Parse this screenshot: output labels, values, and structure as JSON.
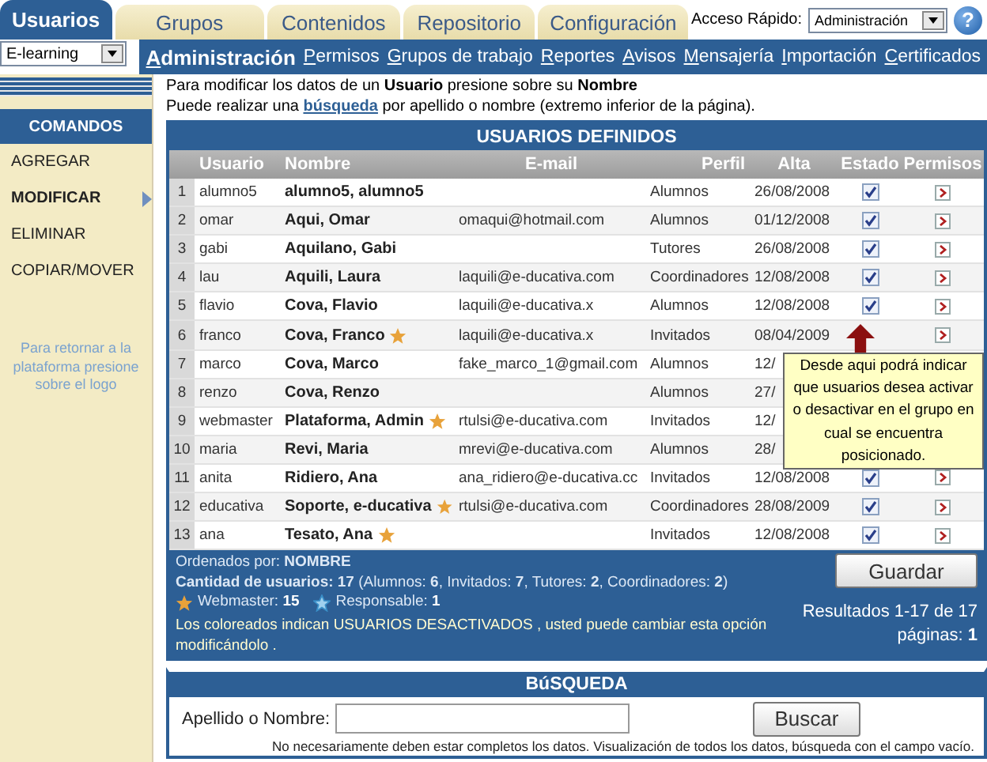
{
  "top_tabs": [
    {
      "label": "Usuarios",
      "selected": true
    },
    {
      "label": "Grupos",
      "selected": false
    },
    {
      "label": "Contenidos",
      "selected": false
    },
    {
      "label": "Repositorio",
      "selected": false
    },
    {
      "label": "Configuración",
      "selected": false
    }
  ],
  "quick_access": {
    "label": "Acceso Rápido:",
    "value": "Administración"
  },
  "help": "?",
  "platform_select": {
    "value": "E-learning"
  },
  "nav_links": [
    {
      "label": "Administración",
      "selected": true
    },
    {
      "label": "Permisos",
      "selected": false
    },
    {
      "label": "Grupos de trabajo",
      "selected": false
    },
    {
      "label": "Reportes",
      "selected": false
    },
    {
      "label": "Avisos",
      "selected": false
    },
    {
      "label": "Mensajería",
      "selected": false
    },
    {
      "label": "Importación",
      "selected": false
    },
    {
      "label": "Certificados",
      "selected": false
    }
  ],
  "sidebar": {
    "title": "COMANDOS",
    "items": [
      {
        "label": "AGREGAR",
        "selected": false
      },
      {
        "label": "MODIFICAR",
        "selected": true
      },
      {
        "label": "ELIMINAR",
        "selected": false
      },
      {
        "label": "COPIAR/MOVER",
        "selected": false
      }
    ],
    "note": "Para retornar a la plataforma presione sobre el logo"
  },
  "instructions": {
    "line_1": "Para modificar los datos de un **Usuario** presione sobre su **Nombre**",
    "before_link": "Puede realizar una",
    "link": "búsqueda",
    "after_link": "por apellido o nombre (extremo inferior de la página)."
  },
  "table": {
    "title": "USUARIOS DEFINIDOS",
    "columns": [
      "Usuario",
      "Nombre",
      "E-mail",
      "Perfil",
      "Alta",
      "Estado",
      "Permisos"
    ],
    "rows": [
      {
        "n": "1",
        "usuario": "alumno5",
        "nombre": "alumno5, alumno5",
        "starred": false,
        "perfil": "Alumnos",
        "alta": "26/08/2008",
        "active": true,
        "permisos": true
      },
      {
        "n": "2",
        "usuario": "omar",
        "nombre": "Aqui, Omar",
        "starred": false,
        "email": "omaqui@hotmail.com",
        "perfil": "Alumnos",
        "alta": "01/12/2008",
        "active": true,
        "permisos": true
      },
      {
        "n": "3",
        "usuario": "gabi",
        "nombre": "Aquilano, Gabi",
        "starred": false,
        "perfil": "Tutores",
        "alta": "26/08/2008",
        "active": true,
        "permisos": true
      },
      {
        "n": "4",
        "usuario": "lau",
        "nombre": "Aquili, Laura",
        "starred": false,
        "email": "laquili@e-ducativa.com",
        "perfil": "Coordinadores",
        "alta": "12/08/2008",
        "active": true,
        "permisos": true
      },
      {
        "n": "5",
        "usuario": "flavio",
        "nombre": "Cova, Flavio",
        "starred": false,
        "email": "laquili@e-ducativa.x",
        "perfil": "Alumnos",
        "alta": "12/08/2008",
        "active": true,
        "permisos": true
      },
      {
        "n": "6",
        "usuario": "franco",
        "nombre": "Cova, Franco",
        "starred": true,
        "email": "laquili@e-ducativa.x",
        "perfil": "Invitados",
        "alta": "08/04/2009",
        "permisos": true
      },
      {
        "n": "7",
        "usuario": "marco",
        "nombre": "Cova, Marco",
        "starred": false,
        "email": "fake_marco_1@gmail.com",
        "perfil": "Alumnos",
        "alta": "12/"
      },
      {
        "n": "8",
        "usuario": "renzo",
        "nombre": "Cova, Renzo",
        "starred": false,
        "perfil": "Alumnos",
        "alta": "27/"
      },
      {
        "n": "9",
        "usuario": "webmaster",
        "nombre": "Plataforma, Admin",
        "starred": true,
        "email": "rtulsi@e-ducativa.com",
        "perfil": "Invitados",
        "alta": "12/"
      },
      {
        "n": "10",
        "usuario": "maria",
        "nombre": "Revi, Maria",
        "starred": false,
        "email": "mrevi@e-ducativa.com",
        "perfil": "Alumnos",
        "alta": "28/"
      },
      {
        "n": "11",
        "usuario": "anita",
        "nombre": "Ridiero, Ana",
        "starred": false,
        "email": "ana_ridiero@e-ducativa.cc",
        "perfil": "Invitados",
        "alta": "12/08/2008",
        "active": true,
        "permisos": true
      },
      {
        "n": "12",
        "usuario": "educativa",
        "nombre": "Soporte, e-ducativa",
        "starred": true,
        "email": "rtulsi@e-ducativa.com",
        "perfil": "Coordinadores",
        "alta": "28/08/2009",
        "active": true,
        "permisos": true
      },
      {
        "n": "13",
        "usuario": "ana",
        "nombre": "Tesato, Ana",
        "starred": true,
        "perfil": "Invitados",
        "alta": "12/08/2008",
        "active": true,
        "permisos": true
      }
    ]
  },
  "tooltip": "Desde aqui podrá indicar que usuarios desea activar o desactivar en el grupo en cual se encuentra posicionado.",
  "footer": {
    "sort_label": "Ordenados por:",
    "sort_value": "NOMBRE",
    "counts": "**Cantidad de usuarios: 17** (Alumnos: **6**, Invitados: **7**, Tutores: **2**, Coordinadores: **2**)",
    "legend": [
      {
        "kind": "webmaster",
        "label": "Webmaster:",
        "value": "15"
      },
      {
        "kind": "responsable",
        "label": "Responsable:",
        "value": "1"
      }
    ],
    "note": "Los coloreados indican USUARIOS DESACTIVADOS , usted puede cambiar esta opción modificándolo .",
    "save_button": "Guardar",
    "results": "Resultados 1-17 de 17",
    "pages": "páginas: **1**"
  },
  "search": {
    "title": "BúSQUEDA",
    "label": "Apellido o Nombre:",
    "button": "Buscar",
    "hint": "No necesariamente deben estar completos los datos. Visualización de todos los datos, búsqueda con el campo vacío."
  }
}
